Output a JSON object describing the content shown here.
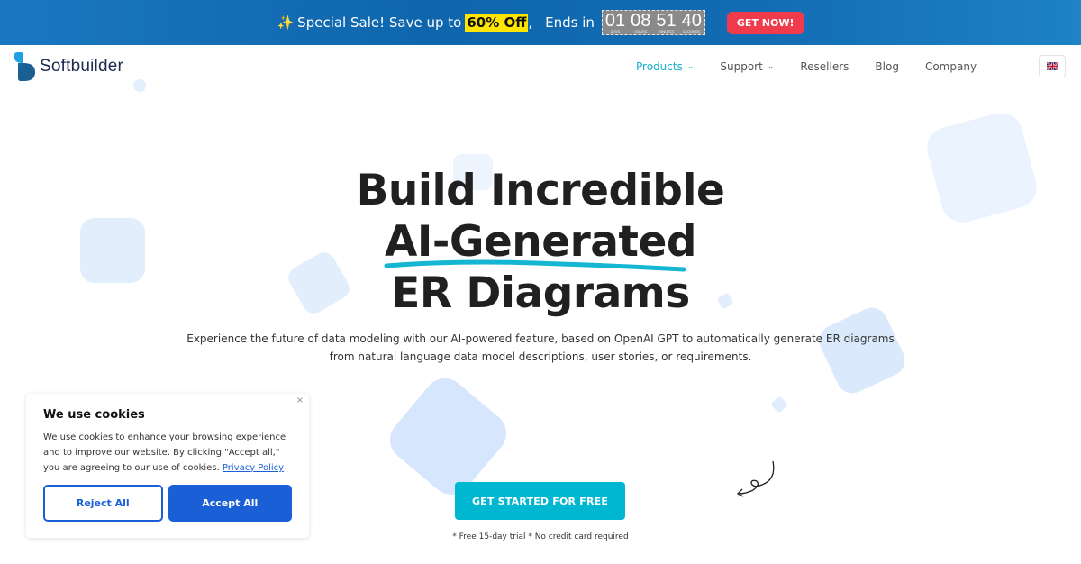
{
  "promo": {
    "prefix": "Special Sale! Save up to",
    "highlight": "60% Off",
    "comma": ",",
    "ends_label": "Ends in",
    "countdown": [
      {
        "value": "01",
        "unit": "DAYS"
      },
      {
        "value": "08",
        "unit": "HOURS"
      },
      {
        "value": "51",
        "unit": "MINUTES"
      },
      {
        "value": "40",
        "unit": "SECONDS"
      }
    ],
    "cta_label": "GET NOW!",
    "sparkle_icon": "✨"
  },
  "nav": {
    "brand": "Softbuilder",
    "items": [
      {
        "label": "Products",
        "has_dropdown": true,
        "active": true
      },
      {
        "label": "Support",
        "has_dropdown": true,
        "active": false
      },
      {
        "label": "Resellers",
        "has_dropdown": false,
        "active": false
      },
      {
        "label": "Blog",
        "has_dropdown": false,
        "active": false
      },
      {
        "label": "Company",
        "has_dropdown": false,
        "active": false
      }
    ],
    "chevron": "⌄",
    "language": "English (UK)"
  },
  "hero": {
    "line1": "Build Incredible",
    "line2": "AI-Generated",
    "line3": "ER Diagrams",
    "description_line1": "Experience the future of data modeling with our AI-powered feature, based on OpenAI GPT to automatically generate ER diagrams",
    "description_line2": "from natural language data model descriptions, user stories, or requirements.",
    "cta_label": "GET STARTED FOR FREE",
    "note": "* Free 15-day trial * No credit card required"
  },
  "cookie": {
    "title": "We use cookies",
    "body": "We use cookies to enhance your browsing experience and to improve our website. By clicking \"Accept all,\" you are agreeing to our use of cookies.",
    "link": "Privacy Policy",
    "reject_label": "Reject All",
    "accept_label": "Accept All",
    "close_label": "×"
  },
  "colors": {
    "accent": "#00b7d2",
    "promo_bg": "#1570b8",
    "sale_red": "#ef3b4c",
    "highlight_yellow": "#ffe600",
    "cookie_blue": "#1a5fd6",
    "shape_fill": "#e3eefc"
  }
}
